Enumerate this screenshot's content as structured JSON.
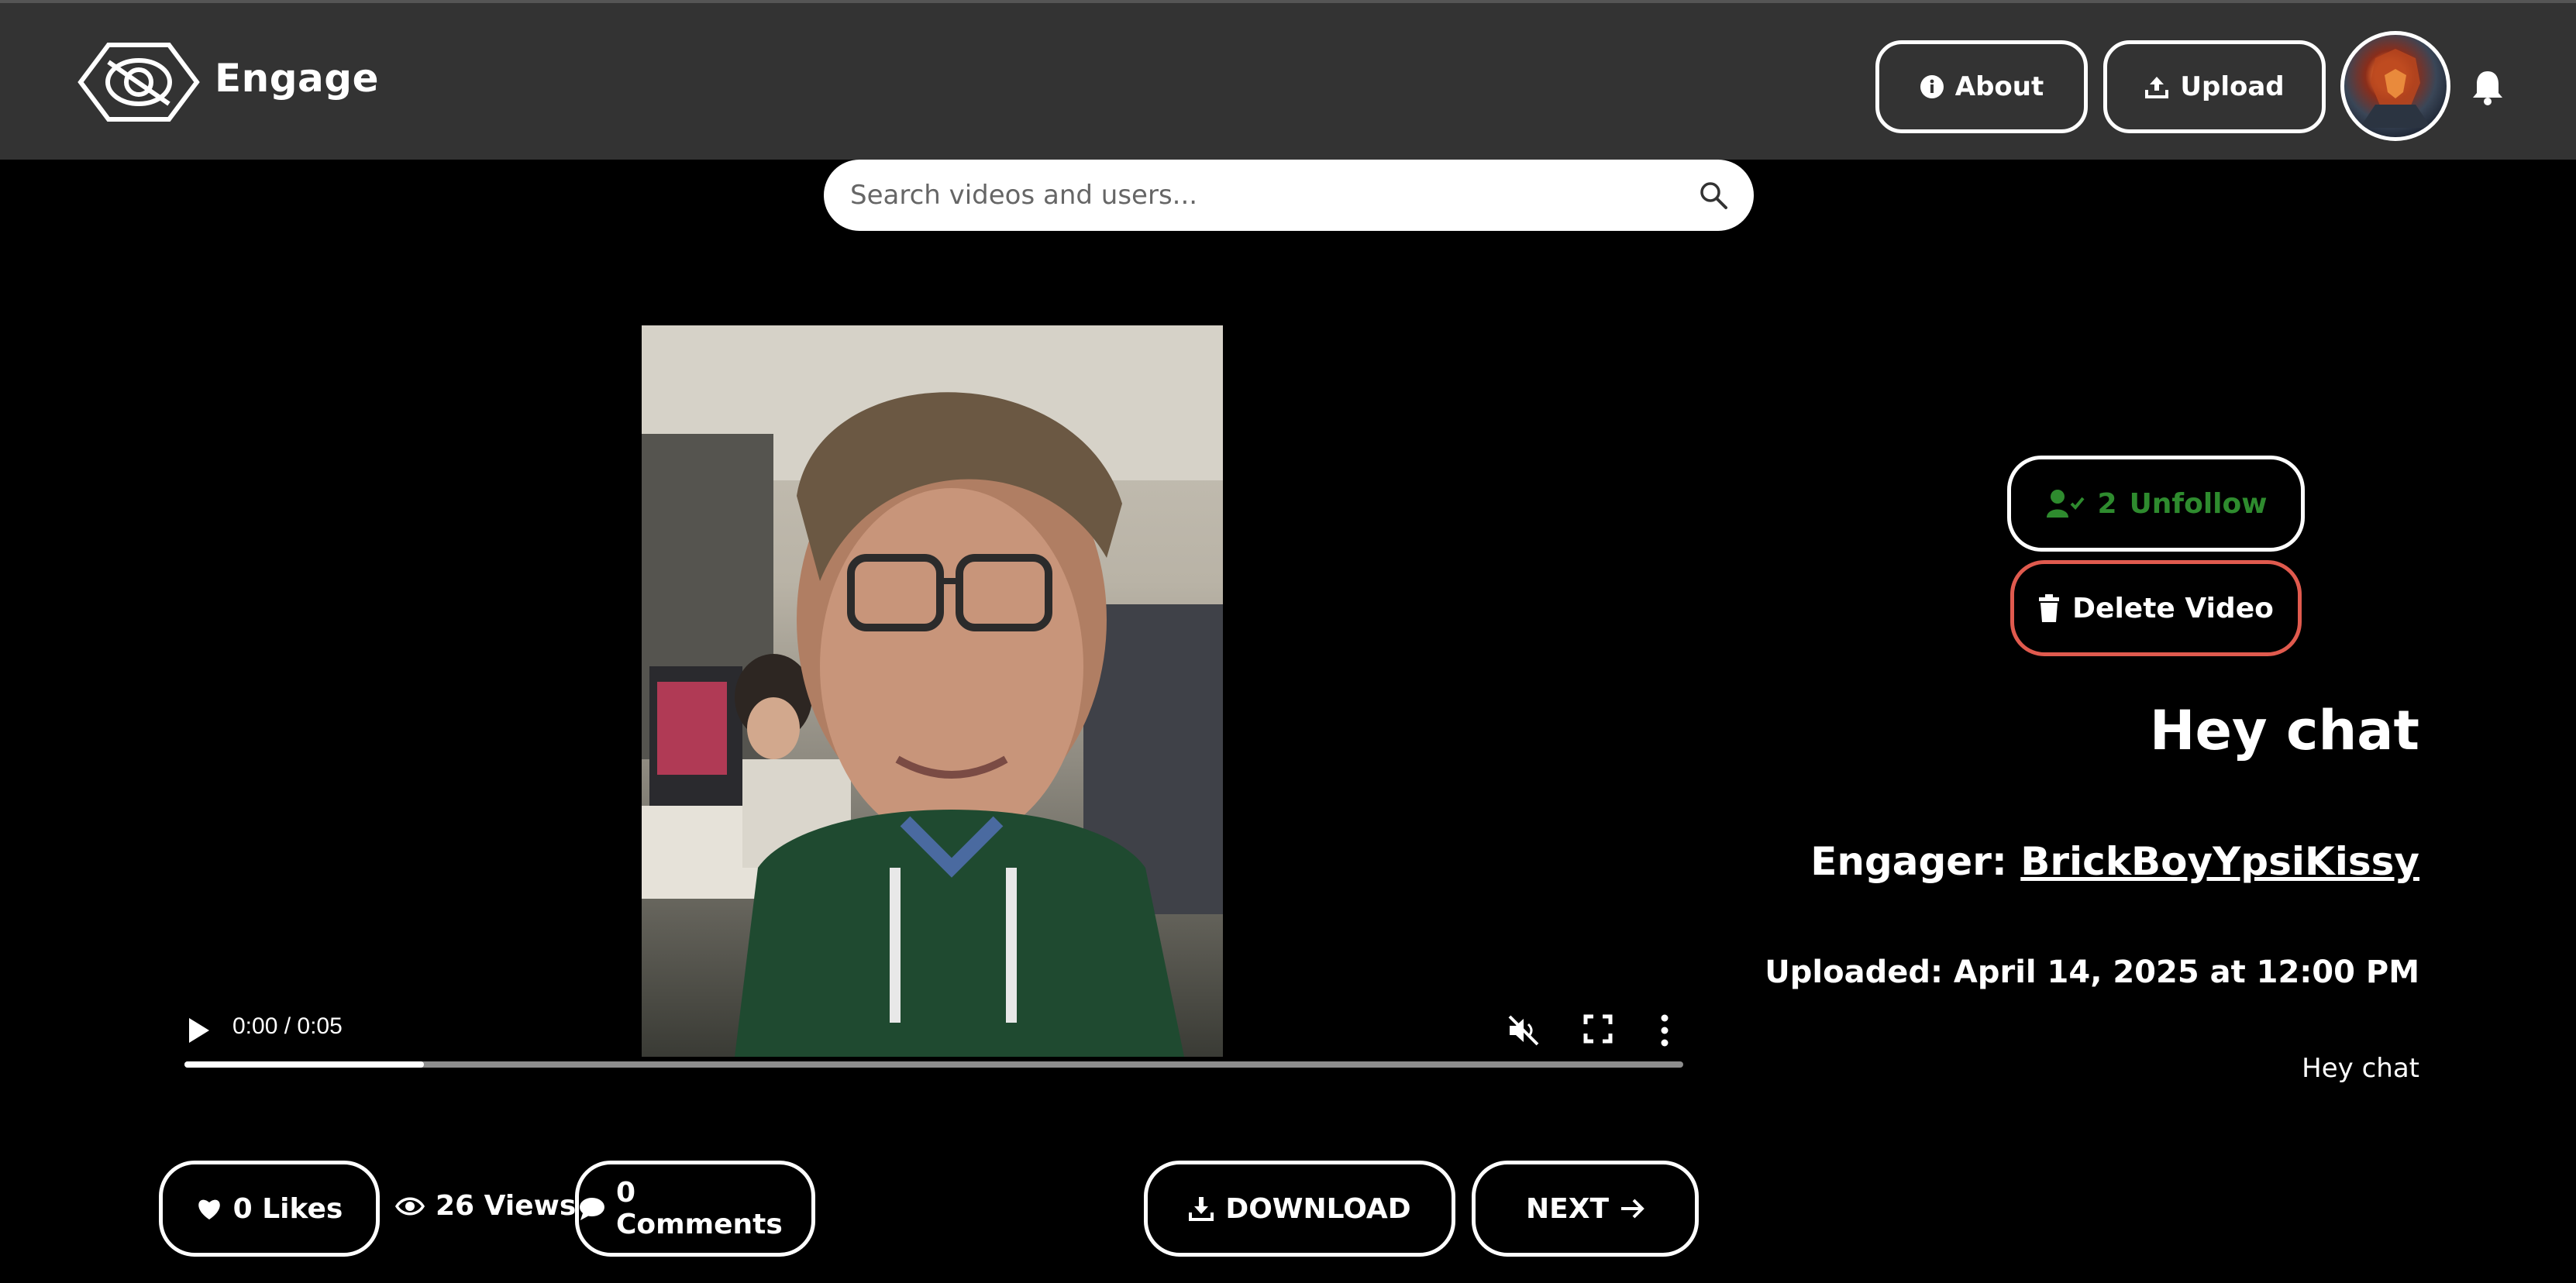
{
  "header": {
    "brand": "Engage",
    "about_label": "About",
    "upload_label": "Upload"
  },
  "search": {
    "placeholder": "Search videos and users..."
  },
  "player": {
    "time": "0:00 / 0:05",
    "progress_fraction": 0.16
  },
  "sidebar": {
    "follower_count": "2",
    "follow_label": "Unfollow",
    "delete_label": "Delete Video",
    "title": "Hey chat",
    "engager_prefix": "Engager: ",
    "engager_name": "BrickBoyYpsiKissy",
    "uploaded": "Uploaded: April 14, 2025 at 12:00 PM",
    "description": "Hey chat"
  },
  "stats": {
    "likes": "0 Likes",
    "views": "26 Views",
    "comments": "0 Comments"
  },
  "actions": {
    "download": "DOWNLOAD",
    "next": "NEXT"
  },
  "colors": {
    "header_bg": "#333333",
    "follow_green": "#2e8b2e",
    "delete_red": "#e05a4e"
  }
}
